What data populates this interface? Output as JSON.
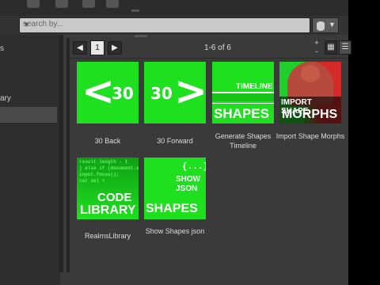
{
  "search": {
    "placeholder": "search by..."
  },
  "left_panel": {
    "items": [
      {
        "label": "s"
      },
      {
        "label": "ary"
      },
      {
        "label": ""
      }
    ]
  },
  "pager": {
    "prev": "◀",
    "page": "1",
    "next": "▶",
    "count": "1-6 of 6"
  },
  "zoom": {
    "plus": "+",
    "minus": "-"
  },
  "tiles": [
    {
      "caption": "30 Back",
      "glyph": "<",
      "num": "30"
    },
    {
      "caption": "30 Forward",
      "glyph": ">",
      "num": "30"
    },
    {
      "caption": "Generate Shapes Timeline",
      "line1": "TIMELINE",
      "line2": "SHAPES"
    },
    {
      "caption": "Import Shape Morphs",
      "line1": "IMPORT SHAPE",
      "line2": "MORPHS"
    },
    {
      "caption": "RealmsLibrary",
      "line1": "CODE",
      "line2": "LIBRARY",
      "code": "result.length - 1\n} else if (document.se\ninput.focus();\nvar sel ="
    },
    {
      "caption": "Show Shapes json",
      "line1": "{...}",
      "line2": "SHOW",
      "line3": "JSON",
      "line4": "SHAPES"
    }
  ],
  "colors": {
    "tile_green": "#1fe01f",
    "panel_bg": "#3a3a3a"
  }
}
